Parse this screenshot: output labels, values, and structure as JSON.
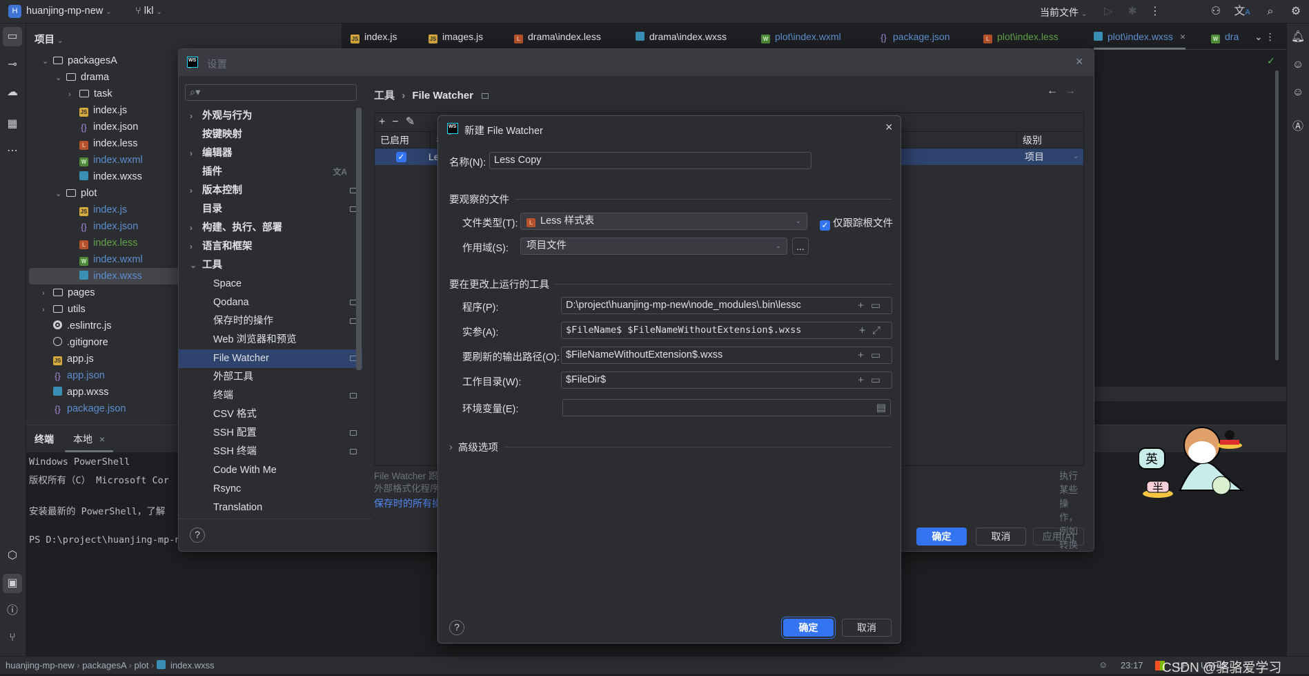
{
  "topbar": {
    "project_badge": "H",
    "project": "huanjing-mp-new",
    "branch": "lkl",
    "run_config": "当前文件"
  },
  "project_panel": {
    "title": "项目",
    "tree": [
      {
        "name": "packagesA",
        "depth": 1,
        "type": "folder",
        "color": "white",
        "expander": "open"
      },
      {
        "name": "drama",
        "depth": 2,
        "type": "folder",
        "color": "white",
        "expander": "open"
      },
      {
        "name": "task",
        "depth": 3,
        "type": "folder",
        "color": "white",
        "expander": "closed"
      },
      {
        "name": "index.js",
        "depth": 3,
        "type": "js",
        "color": "white"
      },
      {
        "name": "index.json",
        "depth": 3,
        "type": "json",
        "color": "white"
      },
      {
        "name": "index.less",
        "depth": 3,
        "type": "less",
        "color": "white"
      },
      {
        "name": "index.wxml",
        "depth": 3,
        "type": "wxml",
        "color": "blue"
      },
      {
        "name": "index.wxss",
        "depth": 3,
        "type": "wxss",
        "color": "white"
      },
      {
        "name": "plot",
        "depth": 2,
        "type": "folder",
        "color": "white",
        "expander": "open"
      },
      {
        "name": "index.js",
        "depth": 3,
        "type": "js",
        "color": "blue"
      },
      {
        "name": "index.json",
        "depth": 3,
        "type": "json",
        "color": "blue"
      },
      {
        "name": "index.less",
        "depth": 3,
        "type": "less",
        "color": "green"
      },
      {
        "name": "index.wxml",
        "depth": 3,
        "type": "wxml",
        "color": "blue"
      },
      {
        "name": "index.wxss",
        "depth": 3,
        "type": "wxss",
        "color": "blue",
        "selected": true
      },
      {
        "name": "pages",
        "depth": 1,
        "type": "folder",
        "color": "white",
        "expander": "closed"
      },
      {
        "name": "utils",
        "depth": 1,
        "type": "folder",
        "color": "white",
        "expander": "closed"
      },
      {
        "name": ".eslintrc.js",
        "depth": 1,
        "type": "eslint",
        "color": "white"
      },
      {
        "name": ".gitignore",
        "depth": 1,
        "type": "git",
        "color": "white"
      },
      {
        "name": "app.js",
        "depth": 1,
        "type": "js",
        "color": "white"
      },
      {
        "name": "app.json",
        "depth": 1,
        "type": "json",
        "color": "blue"
      },
      {
        "name": "app.wxss",
        "depth": 1,
        "type": "wxss",
        "color": "white"
      },
      {
        "name": "package.json",
        "depth": 1,
        "type": "json",
        "color": "blue"
      }
    ]
  },
  "editor_tabs": [
    {
      "label": "index.js",
      "type": "js",
      "color": "white"
    },
    {
      "label": "images.js",
      "type": "js",
      "color": "white"
    },
    {
      "label": "drama\\index.less",
      "type": "less",
      "color": "white"
    },
    {
      "label": "drama\\index.wxss",
      "type": "wxss",
      "color": "white"
    },
    {
      "label": "plot\\index.wxml",
      "type": "wxml",
      "color": "blue"
    },
    {
      "label": "package.json",
      "type": "json",
      "color": "blue"
    },
    {
      "label": "plot\\index.less",
      "type": "less",
      "color": "green"
    },
    {
      "label": "plot\\index.wxss",
      "type": "wxss",
      "color": "blue",
      "active": true,
      "close": "×"
    },
    {
      "label": "dra",
      "type": "wxml",
      "color": "blue"
    }
  ],
  "terminal": {
    "tabs": [
      "终端",
      "本地"
    ],
    "close": "×",
    "lines": [
      "Windows PowerShell",
      "版权所有（C） Microsoft Cor",
      "",
      "安装最新的 PowerShell，了解",
      "",
      "PS D:\\project\\huanjing-mp-n"
    ]
  },
  "settings": {
    "title": "设置",
    "search_placeholder": "",
    "nav": [
      {
        "label": "外观与行为",
        "bold": true,
        "expander": "closed"
      },
      {
        "label": "按键映射",
        "bold": true
      },
      {
        "label": "编辑器",
        "bold": true,
        "expander": "closed"
      },
      {
        "label": "插件",
        "bold": true,
        "badge": "translate"
      },
      {
        "label": "版本控制",
        "bold": true,
        "expander": "closed",
        "badge": "project"
      },
      {
        "label": "目录",
        "bold": true,
        "badge": "project"
      },
      {
        "label": "构建、执行、部署",
        "bold": true,
        "expander": "closed"
      },
      {
        "label": "语言和框架",
        "bold": true,
        "expander": "closed"
      },
      {
        "label": "工具",
        "bold": true,
        "expander": "open"
      },
      {
        "label": "Space",
        "sub": true
      },
      {
        "label": "Qodana",
        "sub": true,
        "badge": "project"
      },
      {
        "label": "保存时的操作",
        "sub": true,
        "badge": "project"
      },
      {
        "label": "Web 浏览器和预览",
        "sub": true
      },
      {
        "label": "File Watcher",
        "sub": true,
        "badge": "project",
        "selected": true
      },
      {
        "label": "外部工具",
        "sub": true
      },
      {
        "label": "终端",
        "sub": true,
        "badge": "project"
      },
      {
        "label": "CSV 格式",
        "sub": true
      },
      {
        "label": "SSH 配置",
        "sub": true,
        "badge": "project"
      },
      {
        "label": "SSH 终端",
        "sub": true,
        "badge": "project"
      },
      {
        "label": "Code With Me",
        "sub": true
      },
      {
        "label": "Rsync",
        "sub": true
      },
      {
        "label": "Translation",
        "sub": true
      }
    ],
    "breadcrumb": [
      "工具",
      "File Watcher"
    ],
    "table": {
      "headers": [
        "已启用",
        "名",
        "级别"
      ],
      "row": {
        "enabled": true,
        "name": "Le",
        "level": "项目"
      }
    },
    "description": [
      "File Watcher 跟",
      "外部格式化程序",
      "执行某些操作，例如转换已编辑的文件或使用"
    ],
    "link": "保存时的所有操",
    "ok": "确定",
    "cancel": "取消",
    "apply": "应用(A)",
    "help": "?"
  },
  "new_watcher": {
    "title": "新建 File Watcher",
    "name_label": "名称(N):",
    "name_value": "Less Copy",
    "section_files": "要观察的文件",
    "file_type_label": "文件类型(T):",
    "file_type_value": "Less 样式表",
    "track_root_label": "仅跟踪根文件",
    "track_root_checked": true,
    "scope_label": "作用域(S):",
    "scope_value": "项目文件",
    "scope_more": "...",
    "section_tool": "要在更改上运行的工具",
    "program_label": "程序(P):",
    "program_value": "D:\\project\\huanjing-mp-new\\node_modules\\.bin\\lessc",
    "args_label": "实参(A):",
    "args_value": "$FileName$ $FileNameWithoutExtension$.wxss",
    "output_label": "要刷新的输出路径(O):",
    "output_value": "$FileNameWithoutExtension$.wxss",
    "workdir_label": "工作目录(W):",
    "workdir_value": "$FileDir$",
    "env_label": "环境变量(E):",
    "env_value": "",
    "advanced": "高级选项",
    "ok": "确定",
    "cancel": "取消",
    "help": "?"
  },
  "statusbar": {
    "breadcrumb": [
      "huanjing-mp-new",
      "packagesA",
      "plot",
      "index.wxss"
    ],
    "time": "23:17",
    "line_sep": "LF",
    "encoding": "UTF-8",
    "watermark": "CSDN @骆骆爱学习"
  },
  "mascot": {
    "sign_text": "英",
    "bowl_text": "半"
  },
  "colors": {
    "accent": "#3574f0",
    "selection": "#2e436e",
    "vcs_modified": "#5e8fd0",
    "vcs_added": "#62a24b"
  }
}
